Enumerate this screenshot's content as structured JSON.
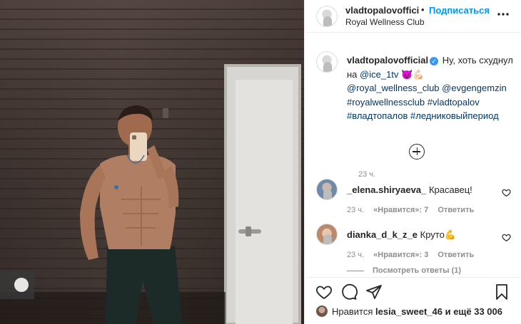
{
  "header": {
    "username": "vladtopalovoffici",
    "separator": "•",
    "follow_label": "Подписаться",
    "location": "Royal Wellness Club",
    "more_icon": "more-horizontal-icon"
  },
  "caption": {
    "username": "vladtopalovofficial",
    "verified_icon": "verified-badge-icon",
    "text_before": "Ну, хоть схуднул на ",
    "mention_1": "@ice_1tv",
    "emoji": "😈💪🏻",
    "mention_2": "@royal_wellness_club",
    "mention_3": "@evgengemzin",
    "hashtags": "#royalwellnessclub #vladtopalov #владтопалов #ледниковыйпериод",
    "time": "23 ч."
  },
  "load_more_icon": "plus-circle-icon",
  "comments": [
    {
      "username": "_elena.shiryaeva_",
      "text": "Красавец!",
      "time": "23 ч.",
      "likes": "«Нравится»: 7",
      "reply": "Ответить"
    },
    {
      "username": "dianka_d_k_z_e",
      "text": "Круто💪",
      "time": "23 ч.",
      "likes": "«Нравится»: 3",
      "reply": "Ответить"
    }
  ],
  "view_replies": "Посмотреть ответы (1)",
  "actions": {
    "like_icon": "heart-icon",
    "comment_icon": "comment-icon",
    "share_icon": "paper-plane-icon",
    "save_icon": "bookmark-icon"
  },
  "likes_line": {
    "prefix": "Нравится",
    "user": "lesia_sweet_46",
    "suffix": "и ещё 33 006"
  },
  "colors": {
    "accent": "#0095f6",
    "link": "#00376b",
    "muted": "#8e8e8e"
  }
}
